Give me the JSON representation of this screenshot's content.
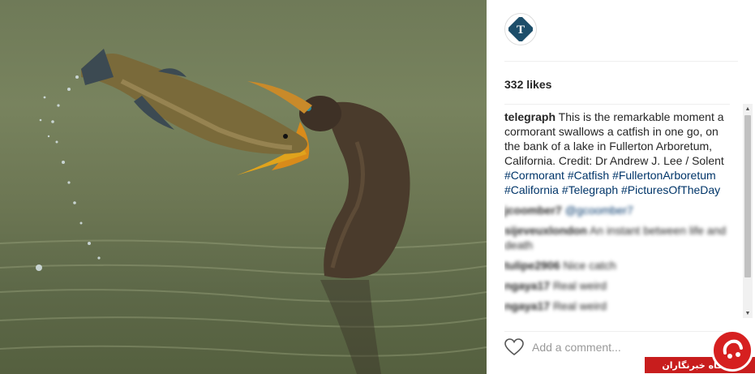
{
  "post": {
    "account": "telegraph",
    "likes": "332 likes",
    "caption_user": "telegraph",
    "caption_text": "This is the remarkable moment a cormorant swallows a catfish in one go, on the bank of a lake in Fullerton Arboretum, California. Credit: Dr Andrew J. Lee / Solent",
    "hashtags": [
      "#Cormorant",
      "#Catfish",
      "#FullertonArboretum",
      "#California",
      "#Telegraph",
      "#PicturesOfTheDay"
    ]
  },
  "comments": [
    {
      "user": "jcoomber7",
      "mention": "@gcoomber7",
      "text": ""
    },
    {
      "user": "sijeveuxlondon",
      "mention": "",
      "text": "An instant between life and death"
    },
    {
      "user": "tulipe2906",
      "mention": "",
      "text": "Nice catch"
    },
    {
      "user": "ngaya17",
      "mention": "",
      "text": "Real weird"
    },
    {
      "user": "ngaya17",
      "mention": "",
      "text": "Real weird"
    }
  ],
  "add_comment": {
    "placeholder": "Add a comment..."
  },
  "watermark": {
    "text": "باشگاه خبرنگاران"
  },
  "icons": {
    "heart": "heart-outline-icon",
    "avatar": "telegraph-logo-icon",
    "scroll_up": "scroll-up-arrow-icon",
    "scroll_down": "scroll-down-arrow-icon"
  },
  "colors": {
    "hashtag": "#003569",
    "text": "#262626",
    "placeholder": "#999999",
    "watermark_red": "#c81d1d"
  }
}
